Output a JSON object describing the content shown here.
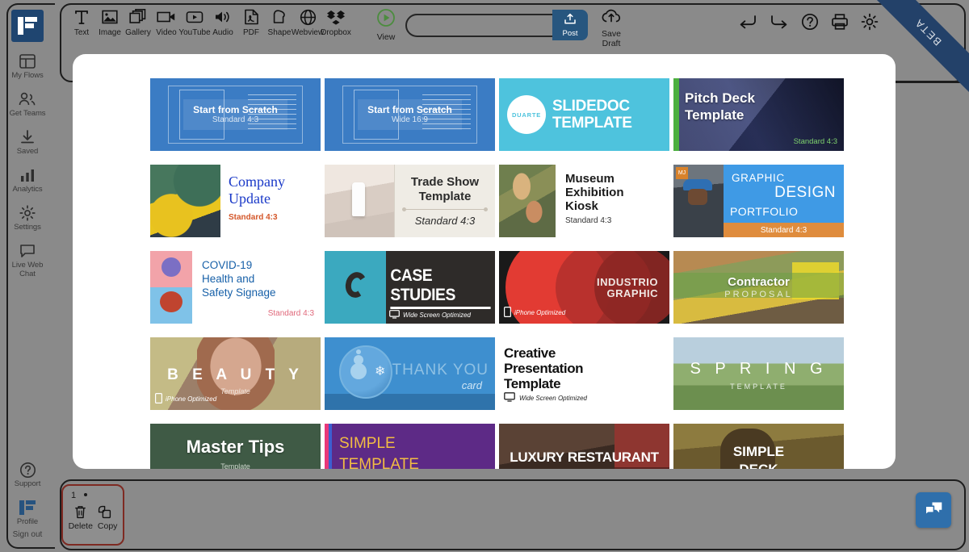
{
  "app": {
    "brand_color": "#1f4570",
    "beta_badge": "BETA"
  },
  "sidebar": {
    "logo_name": "flowvella-logo",
    "items": [
      {
        "icon": "layout-icon",
        "label": "My Flows"
      },
      {
        "icon": "people-icon",
        "label": "Get Teams"
      },
      {
        "icon": "download-icon",
        "label": "Saved"
      },
      {
        "icon": "bar-chart-icon",
        "label": "Analytics"
      },
      {
        "icon": "gear-icon",
        "label": "Settings"
      },
      {
        "icon": "chat-bubble-icon",
        "label": "Live Web Chat"
      }
    ],
    "bottom": {
      "support_label": "Support",
      "profile_label": "Profile",
      "signout_label": "Sign out"
    }
  },
  "toolbar": {
    "tools": [
      {
        "icon": "text-icon",
        "label": "Text"
      },
      {
        "icon": "image-icon",
        "label": "Image"
      },
      {
        "icon": "gallery-icon",
        "label": "Gallery"
      },
      {
        "icon": "video-icon",
        "label": "Video"
      },
      {
        "icon": "youtube-icon",
        "label": "YouTube"
      },
      {
        "icon": "audio-icon",
        "label": "Audio"
      },
      {
        "icon": "pdf-icon",
        "label": "PDF"
      },
      {
        "icon": "shape-icon",
        "label": "Shape"
      },
      {
        "icon": "webview-icon",
        "label": "Webview"
      },
      {
        "icon": "dropbox-icon",
        "label": "Dropbox"
      }
    ],
    "view_label": "View",
    "post_placeholder": "",
    "post_value": "",
    "post_label": "Post",
    "save_draft_line1": "Save",
    "save_draft_line2": "Draft",
    "right_icons": [
      {
        "icon": "undo-icon",
        "label": "Undo"
      },
      {
        "icon": "redo-icon",
        "label": "Redo"
      },
      {
        "icon": "help-icon",
        "label": "Help"
      },
      {
        "icon": "print-icon",
        "label": "Print"
      },
      {
        "icon": "gear-icon",
        "label": "Settings"
      }
    ]
  },
  "templates": [
    {
      "id": "start-scratch-43",
      "title": "Start from Scratch",
      "subtitle": "Standard 4:3",
      "badge": ""
    },
    {
      "id": "start-scratch-169",
      "title": "Start from Scratch",
      "subtitle": "Wide 16:9",
      "badge": ""
    },
    {
      "id": "slidedoc",
      "title": "SLIDEDOC",
      "title2": "TEMPLATE",
      "brand": "DUARTE",
      "subtitle": ""
    },
    {
      "id": "pitch-deck",
      "title": "Pitch Deck",
      "title2": "Template",
      "subtitle": "Standard 4:3"
    },
    {
      "id": "company-update",
      "title": "Company",
      "title2": "Update",
      "subtitle": "Standard 4:3"
    },
    {
      "id": "trade-show",
      "title": "Trade Show",
      "title2": "Template",
      "subtitle": "Standard 4:3"
    },
    {
      "id": "museum-exhibition-kiosk",
      "title": "Museum",
      "title2": "Exhibition",
      "title3": "Kiosk",
      "subtitle": "Standard 4:3"
    },
    {
      "id": "graphic-design-portfolio",
      "title": "GRAPHIC",
      "title2": "DESIGN",
      "title3": "PORTFOLIO",
      "brand": "MJ",
      "subtitle": "Standard 4:3"
    },
    {
      "id": "covid-19-signage",
      "title": "COVID-19",
      "title2": "Health and",
      "title3": "Safety Signage",
      "subtitle": "Standard 4:3"
    },
    {
      "id": "case-studies",
      "title": "CASE STUDIES",
      "badge": "Wide Screen Optimized"
    },
    {
      "id": "industrio-graphic",
      "title": "INDUSTRIO",
      "title2": "GRAPHIC",
      "badge": "iPhone Optimized"
    },
    {
      "id": "contractor-proposal",
      "title": "Contractor",
      "title2": "PROPOSAL"
    },
    {
      "id": "beauty",
      "title": "B E A U T Y",
      "subtitle": "Template",
      "badge": "iPhone Optimized"
    },
    {
      "id": "thank-you-card",
      "title": "THANK YOU",
      "subtitle": "card"
    },
    {
      "id": "creative-presentation",
      "title": "Creative",
      "title2": "Presentation",
      "title3": "Template",
      "badge": "Wide Screen Optimized"
    },
    {
      "id": "spring-template",
      "title": "S P R I N G",
      "subtitle": "TEMPLATE"
    },
    {
      "id": "master-tips",
      "title": "Master Tips",
      "subtitle": "Template"
    },
    {
      "id": "simple-template",
      "title": "SIMPLE",
      "title2": "TEMPLATE"
    },
    {
      "id": "luxury-restaurant",
      "title": "LUXURY RESTAURANT"
    },
    {
      "id": "simple-deck",
      "title": "SIMPLE",
      "title2": "DECK"
    }
  ],
  "bottom_bar": {
    "slide_number": "1",
    "delete_label": "Delete",
    "copy_label": "Copy",
    "chat_icon": "chat-bubbles-icon"
  }
}
